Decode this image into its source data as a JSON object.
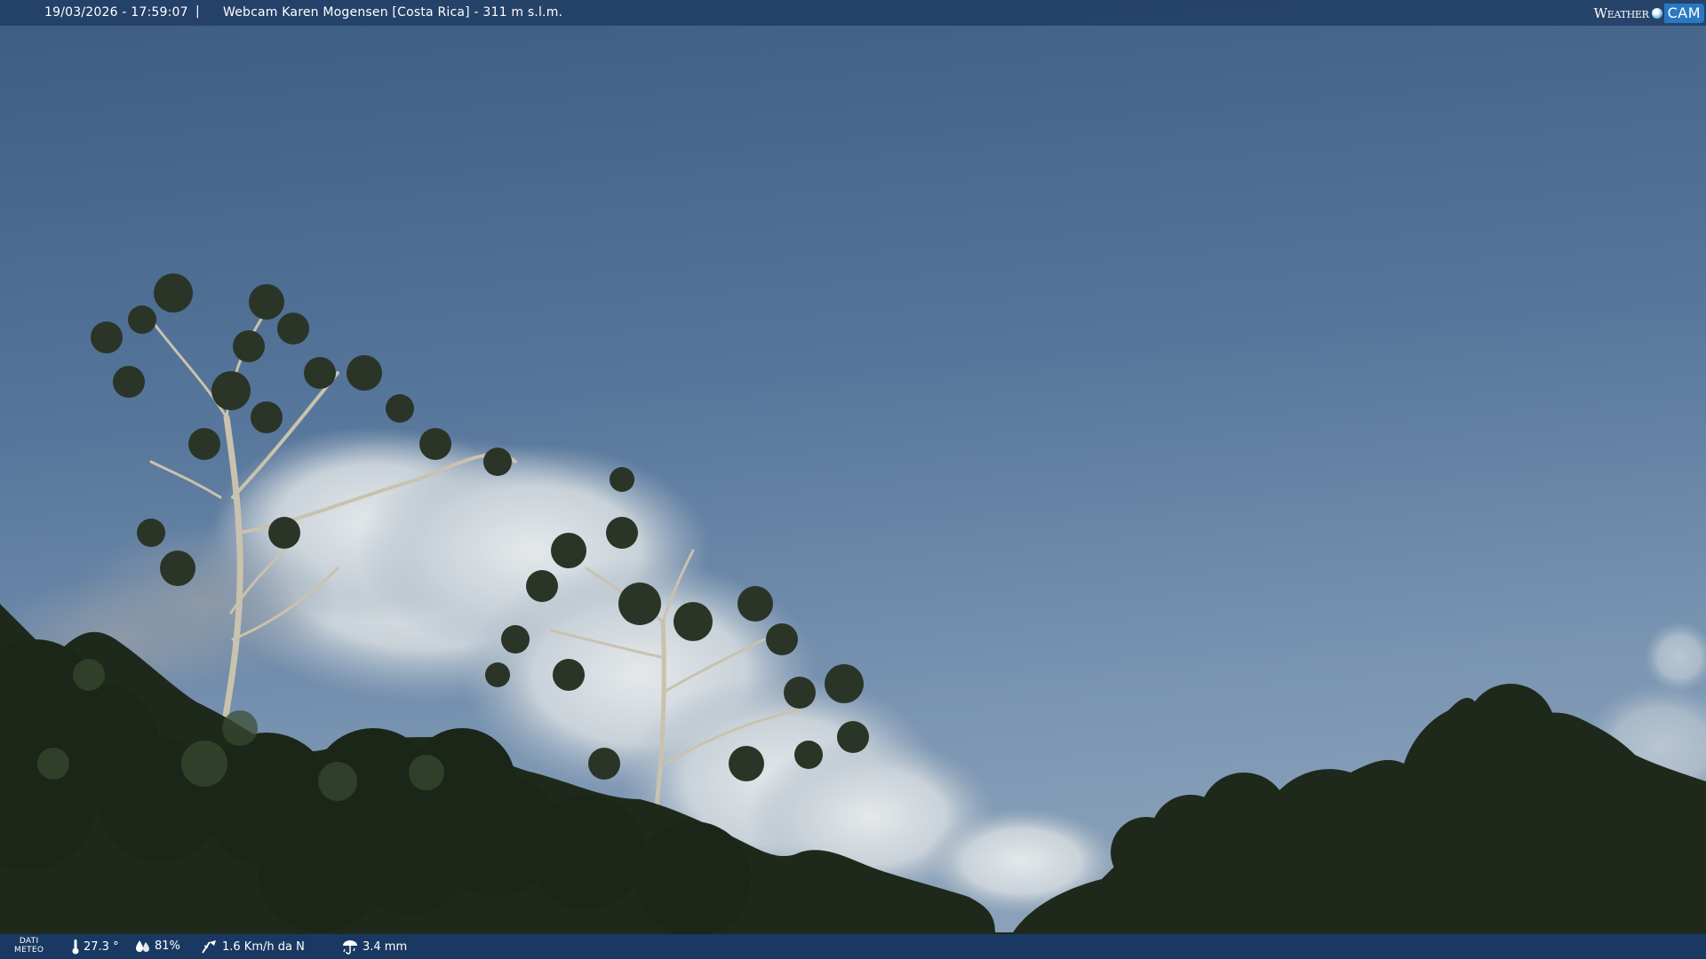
{
  "overlay": {
    "datetime": "19/03/2026 - 17:59:07",
    "separator": "|",
    "title": "Webcam Karen Mogensen [Costa Rica] - 311 m s.l.m."
  },
  "logo": {
    "weather_text": "Weather",
    "cam_text": "CAM",
    "icon": "globe-icon"
  },
  "meteo": {
    "label_line1": "DATI",
    "label_line2": "METEO",
    "temperature": "27.3 °",
    "temperature_icon": "thermometer-icon",
    "humidity": "81%",
    "humidity_icon": "humidity-drop-icon",
    "wind": "1.6 Km/h da N",
    "wind_icon": "wind-icon",
    "rain": "3.4 mm",
    "rain_icon": "rain-gauge-icon"
  },
  "colors": {
    "sky_top": "#3f5f86",
    "sky_bottom": "#7e98b5",
    "cloud": "#dde3e6",
    "foliage": "#1f2b1c",
    "bar_bg": "#1e3a62",
    "logo_cam_bg": "#2a78c2"
  }
}
